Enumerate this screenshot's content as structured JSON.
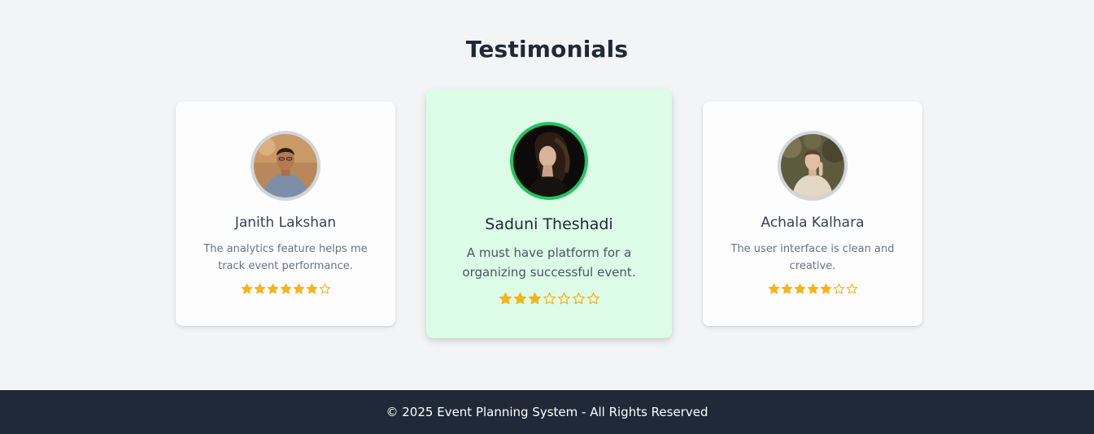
{
  "section": {
    "title": "Testimonials"
  },
  "colors": {
    "star_fill": "#f4b41a",
    "featured_bg": "#dcfce7",
    "featured_ring": "#22c55e",
    "footer_bg": "#1f2937"
  },
  "testimonials": [
    {
      "name": "Janith Lakshan",
      "quote": "The analytics feature helps me track event performance.",
      "rating": 6,
      "max_rating": 7,
      "featured": false,
      "avatar_icon": "person-photo"
    },
    {
      "name": "Saduni Theshadi",
      "quote": "A must have platform for a organizing successful event.",
      "rating": 3,
      "max_rating": 7,
      "featured": true,
      "avatar_icon": "person-photo"
    },
    {
      "name": "Achala Kalhara",
      "quote": "The user interface is clean and creative.",
      "rating": 5,
      "max_rating": 7,
      "featured": false,
      "avatar_icon": "person-photo"
    }
  ],
  "footer": {
    "text": "© 2025 Event Planning System - All Rights Reserved"
  }
}
